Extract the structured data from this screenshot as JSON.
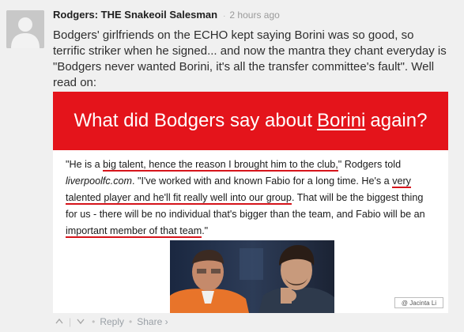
{
  "comment": {
    "author": "Rodgers: THE Snakeoil Salesman",
    "separator": "·",
    "timestamp": "2 hours ago",
    "text": "Bodgers' girlfriends on the ECHO kept saying Borini was so good, so terrific striker when he signed... and now the mantra they chant everyday is \"Bodgers never wanted Borini, it's all the transfer committee's fault\". Well read on:"
  },
  "meme": {
    "banner_before": "What did Bodgers say about ",
    "banner_underlined": "Borini",
    "banner_after": " again?",
    "q1": "\"He is a ",
    "q2": "big talent, hence the reason I brought him to the club,",
    "q3": "\" Rodgers told ",
    "q4": "liverpoolfc.com",
    "q5": ". \"I've worked with and known Fabio for a long time. He's a ",
    "q6": "very talented player and he'll fit really well into our group",
    "q7": ". That will be the biggest thing for us - there will be no individual that's bigger than the team, and Fabio will be an ",
    "q8": "important member of that team",
    "q9": ".\"",
    "watermark": "@ Jacinta Li",
    "colors": {
      "banner": "#e4141b",
      "underline": "#d6141b"
    }
  },
  "actions": {
    "upvote": "^",
    "downvote": "v",
    "reply": "Reply",
    "share": "Share ›",
    "bullet": "•"
  }
}
